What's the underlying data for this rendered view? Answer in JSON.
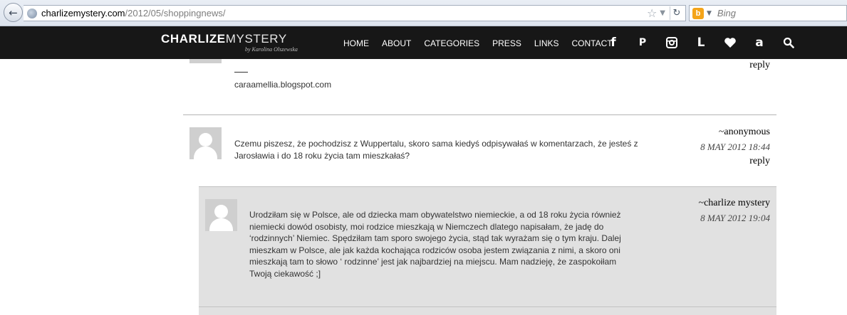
{
  "browser": {
    "url_host": "charlizemystery.com",
    "url_path": "/2012/05/shoppingnews/",
    "search_placeholder": "Bing"
  },
  "site": {
    "logo_bold": "CHARLIZE",
    "logo_light": "MYSTERY",
    "logo_signature": "by Karolina Olszewska",
    "nav": [
      "HOME",
      "ABOUT",
      "CATEGORIES",
      "PRESS",
      "LINKS",
      "CONTACT"
    ],
    "social_icons": [
      "facebook-icon",
      "pinterest-icon",
      "instagram-icon",
      "lookbook-icon",
      "bloglovin-heart-icon",
      "amazon-icon",
      "search-icon"
    ],
    "social_glyphs": {
      "facebook": "f",
      "pinterest": "P",
      "lookbook": "L",
      "amazon": "a"
    }
  },
  "comments": {
    "partial": {
      "signature_dash": "___",
      "blog_url": "caraamellia.blogspot.com",
      "reply_label": "reply"
    },
    "anonymous": {
      "author": "~anonymous",
      "date": "8 MAY 2012 18:44",
      "text_line1": "Czemu piszesz, że pochodzisz z Wuppertalu, skoro sama kiedyś odpisywałaś w komentarzach, że jesteś z",
      "text_line2": "Jarosławia i do 18 roku życia tam mieszkałaś?",
      "reply_label": "reply"
    },
    "charlize_reply": {
      "author": "~charlize mystery",
      "date": "8 MAY 2012 19:04",
      "lines": [
        "Urodziłam się w Polsce, ale od dziecka mam obywatelstwo niemieckie, a od 18 roku życia również",
        "niemiecki dowód osobisty, moi rodzice mieszkają w Niemczech dlatego napisałam, że jadę do",
        "‘rodzinnych’ Niemiec. Spędziłam tam sporo swojego życia, stąd tak wyrażam się o tym kraju. Dalej",
        "mieszkam w Polsce, ale jak każda kochająca rodziców osoba jestem związania z nimi, a skoro oni",
        "mieszkają tam to słowo ‘ rodzinne’ jest jak najbardziej na miejscu. Mam nadzieję, że zaspokoiłam",
        "Twoją ciekawość ;]"
      ]
    }
  }
}
